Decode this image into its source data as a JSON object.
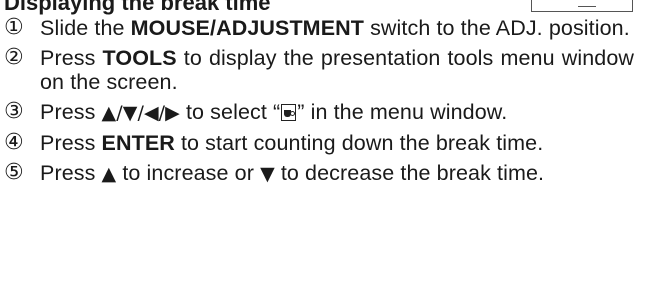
{
  "heading": "Displaying the break time",
  "steps": [
    {
      "num": "①",
      "pre": "Slide the ",
      "bold": "MOUSE/ADJUSTMENT",
      "post": " switch to the ADJ. position."
    },
    {
      "num": "②",
      "pre": "Press ",
      "bold": "TOOLS",
      "post": " to display the presentation tools menu window on the screen."
    },
    {
      "num": "③",
      "pre": "Press ",
      "arrows": "▲/▼/◀/▶",
      "mid": " to select “",
      "icon": "coffee-cup-icon",
      "post": "” in the menu window."
    },
    {
      "num": "④",
      "pre": "Press ",
      "bold": "ENTER",
      "post": " to start counting down the break time."
    },
    {
      "num": "⑤",
      "pre": "Press ",
      "up": "▲",
      "mid": " to increase or ",
      "down": "▼",
      "post": " to decrease the break time."
    }
  ]
}
